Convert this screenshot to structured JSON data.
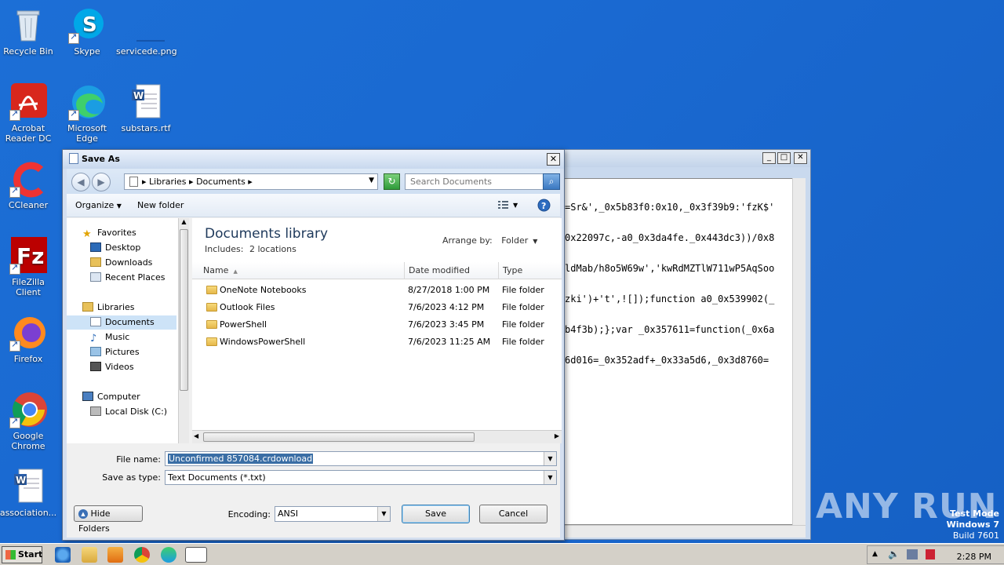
{
  "desktop": {
    "icons": [
      {
        "label": "Recycle Bin"
      },
      {
        "label": "Skype"
      },
      {
        "label": "servicede.png"
      },
      {
        "label": "Acrobat Reader DC"
      },
      {
        "label": "Microsoft Edge"
      },
      {
        "label": "substars.rtf"
      },
      {
        "label": "CCleaner"
      },
      {
        "label": "FileZilla Client"
      },
      {
        "label": "Firefox"
      },
      {
        "label": "Google Chrome"
      },
      {
        "label": "association..."
      }
    ]
  },
  "notepad": {
    "code_lines": [
      "=Sr&',_0x5b83f0:0x10,_0x3f39b9:'fzK$'",
      "0x22097c,-a0_0x3da4fe._0x443dc3))/0x8",
      "ldMab/h8o5W69w','kwRdMZTlW711wP5AqSoo",
      "zki')+'t',![]);function a0_0x539902(_",
      "b4f3b);};var _0x357611=function(_0x6a",
      "6d016=_0x352adf+_0x33a5d6,_0x3d8760="
    ]
  },
  "dialog": {
    "title": "Save As",
    "address": {
      "crumb1": "Libraries",
      "crumb2": "Documents"
    },
    "search": {
      "placeholder": "Search Documents"
    },
    "toolbar": {
      "organize": "Organize",
      "new_folder": "New folder"
    },
    "nav": {
      "favorites": "Favorites",
      "desktop": "Desktop",
      "downloads": "Downloads",
      "recent": "Recent Places",
      "libraries": "Libraries",
      "documents": "Documents",
      "music": "Music",
      "pictures": "Pictures",
      "videos": "Videos",
      "computer": "Computer",
      "local_disk": "Local Disk (C:)"
    },
    "library": {
      "title": "Documents library",
      "includes_label": "Includes:",
      "includes_value": "2 locations",
      "arrange_label": "Arrange by:",
      "arrange_value": "Folder"
    },
    "columns": {
      "name": "Name",
      "date": "Date modified",
      "type": "Type"
    },
    "files": [
      {
        "name": "OneNote Notebooks",
        "date": "8/27/2018 1:00 PM",
        "type": "File folder"
      },
      {
        "name": "Outlook Files",
        "date": "7/6/2023 4:12 PM",
        "type": "File folder"
      },
      {
        "name": "PowerShell",
        "date": "7/6/2023 3:45 PM",
        "type": "File folder"
      },
      {
        "name": "WindowsPowerShell",
        "date": "7/6/2023 11:25 AM",
        "type": "File folder"
      }
    ],
    "filename_label": "File name:",
    "filename_value": "Unconfirmed 857084.crdownload",
    "savetype_label": "Save as type:",
    "savetype_value": "Text Documents (*.txt)",
    "encoding_label": "Encoding:",
    "encoding_value": "ANSI",
    "hide_folders": "Hide Folders",
    "save": "Save",
    "cancel": "Cancel"
  },
  "taskbar": {
    "start": "Start",
    "clock": "2:28 PM"
  },
  "watermark": "ANY RUN",
  "test_mode": {
    "line1": "Test Mode",
    "line2": "Windows 7",
    "line3": "Build 7601"
  }
}
